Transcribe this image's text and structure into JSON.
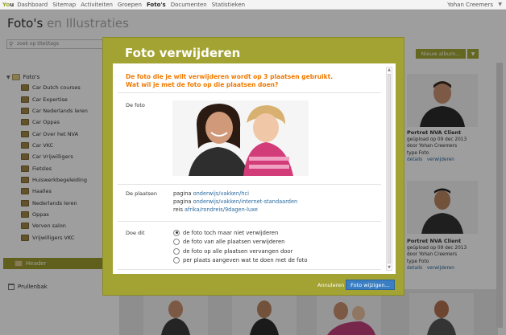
{
  "topbar": {
    "logo_y": "Y",
    "logo_o": "o",
    "logo_u": "u",
    "nav": [
      "Dashboard",
      "Sitemap",
      "Activiteiten",
      "Groepen",
      "Foto's",
      "Documenten",
      "Statistieken"
    ],
    "active_index": 4,
    "user": "Yohan Creemers",
    "user_caret": "▼"
  },
  "page": {
    "title": "Foto's",
    "title_sub": "en Illustraties",
    "search_placeholder": "zoek op titel/tags",
    "new_album": "Nieuw album...",
    "new_album_caret": "▼"
  },
  "tree": {
    "root": "Foto's",
    "items": [
      "Car Dutch courses",
      "Car Expertise",
      "Car Nederlands leren",
      "Car Oppas",
      "Car Over het NVA",
      "Car VKC",
      "Car Vrijwilligers",
      "Fietsles",
      "Huiswerkbegeleiding",
      "Haalles",
      "Nederlands leren",
      "Oppas",
      "Verven salon",
      "Vrijwilligers VKC"
    ],
    "header": "Header",
    "trash": "Prullenbak"
  },
  "cards": [
    {
      "title": "Portret NVA Client",
      "uploaded": "geüpload op 09 dec 2013",
      "by": "door Yohan Creemers",
      "type": "type Foto",
      "details": "details",
      "delete": "verwijderen"
    },
    {
      "title": "Portret NVA Client",
      "uploaded": "geüpload op 09 dec 2013",
      "by": "door Yohan Creemers",
      "type": "type Foto",
      "details": "details",
      "delete": "verwijderen"
    }
  ],
  "modal": {
    "title": "Foto verwijderen",
    "warning_line1": "De foto die je wilt verwijderen wordt op 3 plaatsen gebruikt.",
    "warning_line2": "Wat wil je met de foto op die plaatsen doen?",
    "label_photo": "De foto",
    "label_places": "De plaatsen",
    "label_action": "Doe dit",
    "places": [
      {
        "prefix": "pagina",
        "link": "onderwijs/vakken/hci"
      },
      {
        "prefix": "pagina",
        "link": "onderwijs/vakken/internet-standaarden"
      },
      {
        "prefix": "reis",
        "link": "afrika/rondreis/9dagen-luxe"
      }
    ],
    "options": [
      "de foto toch maar niet verwijderen",
      "de foto van alle plaatsen verwijderen",
      "de foto op alle plaatsen vervangen door",
      "per plaats aangeven wat te doen met de foto"
    ],
    "selected_option": 0,
    "cancel": "Annuleren",
    "submit": "Foto wijzigen...",
    "scroll_up": "▲",
    "scroll_down": "▼"
  },
  "colors": {
    "accent": "#a3a333",
    "warning": "#f07a00",
    "link": "#2a6aa0",
    "button": "#3a7fc4"
  }
}
